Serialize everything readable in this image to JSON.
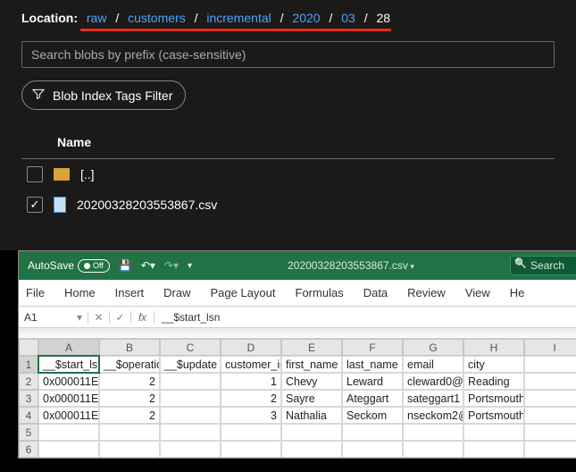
{
  "storage": {
    "location_label": "Location:",
    "breadcrumbs": [
      {
        "label": "raw",
        "link": true
      },
      {
        "label": "customers",
        "link": true
      },
      {
        "label": "incremental",
        "link": true
      },
      {
        "label": "2020",
        "link": true
      },
      {
        "label": "03",
        "link": true
      },
      {
        "label": "28",
        "link": false
      }
    ],
    "search_placeholder": "Search blobs by prefix (case-sensitive)",
    "filter_button": "Blob Index Tags Filter",
    "name_header": "Name",
    "rows": [
      {
        "type": "folder",
        "name": "[..]",
        "checked": false
      },
      {
        "type": "file",
        "name": "20200328203553867.csv",
        "checked": true
      }
    ]
  },
  "excel": {
    "autosave_label": "AutoSave",
    "autosave_state": "Off",
    "filename": "20200328203553867.csv",
    "search_label": "Search",
    "tabs": [
      "File",
      "Home",
      "Insert",
      "Draw",
      "Page Layout",
      "Formulas",
      "Data",
      "Review",
      "View",
      "He"
    ],
    "name_box": "A1",
    "formula": "__$start_lsn",
    "columns": [
      "A",
      "B",
      "C",
      "D",
      "E",
      "F",
      "G",
      "H",
      "I"
    ],
    "row_headers": [
      "1",
      "2",
      "3",
      "4",
      "5",
      "6"
    ],
    "active_cell": "A1",
    "sheet": [
      [
        "__$start_lsn",
        "__$operation",
        "__$update",
        "customer_id",
        "first_name",
        "last_name",
        "email",
        "city",
        ""
      ],
      [
        "0x000011E",
        "2",
        "",
        "1",
        "Chevy",
        "Leward",
        "cleward0@",
        "Reading",
        ""
      ],
      [
        "0x000011E",
        "2",
        "",
        "2",
        "Sayre",
        "Ateggart",
        "sateggart1",
        "Portsmouth",
        ""
      ],
      [
        "0x000011E",
        "2",
        "",
        "3",
        "Nathalia",
        "Seckom",
        "nseckom2@",
        "Portsmouth",
        ""
      ],
      [
        "",
        "",
        "",
        "",
        "",
        "",
        "",
        "",
        ""
      ],
      [
        "",
        "",
        "",
        "",
        "",
        "",
        "",
        "",
        ""
      ]
    ]
  },
  "chart_data": {
    "type": "table",
    "columns": [
      "__$start_lsn",
      "__$operation",
      "__$update",
      "customer_id",
      "first_name",
      "last_name",
      "email",
      "city"
    ],
    "rows": [
      [
        "0x000011E",
        2,
        null,
        1,
        "Chevy",
        "Leward",
        "cleward0@",
        "Reading"
      ],
      [
        "0x000011E",
        2,
        null,
        2,
        "Sayre",
        "Ateggart",
        "sateggart1",
        "Portsmouth"
      ],
      [
        "0x000011E",
        2,
        null,
        3,
        "Nathalia",
        "Seckom",
        "nseckom2@",
        "Portsmouth"
      ]
    ]
  }
}
